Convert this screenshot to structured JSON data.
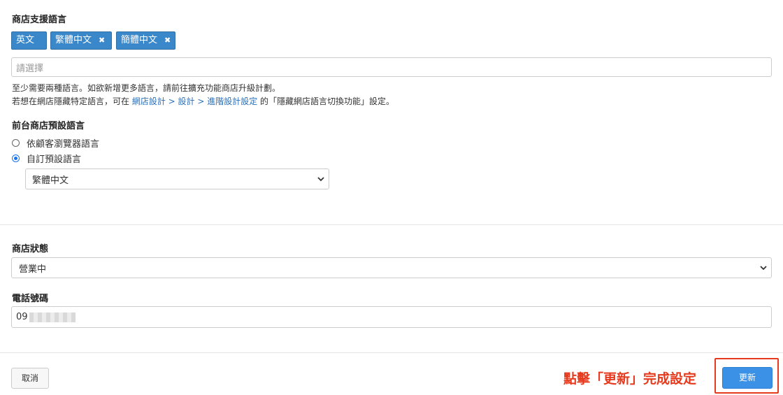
{
  "language": {
    "title": "商店支援語言",
    "tags": [
      {
        "label": "英文",
        "removable": false
      },
      {
        "label": "繁體中文",
        "removable": true,
        "remove_glyph": "✖"
      },
      {
        "label": "簡體中文",
        "removable": true,
        "remove_glyph": "✖"
      }
    ],
    "select_placeholder": "請選擇",
    "help_line1": "至少需要兩種語言。如欲新增更多語言，請前往擴充功能商店升級計劃。",
    "help_line2_prefix": "若想在網店隱藏特定語言，可在",
    "help_line2_link": "網店設計 > 設計 > 進階設計設定",
    "help_line2_suffix": "的「隱藏網店語言切換功能」設定。"
  },
  "default_language": {
    "title": "前台商店預設語言",
    "options": [
      {
        "label": "依顧客瀏覽器語言",
        "selected": false
      },
      {
        "label": "自訂預設語言",
        "selected": true
      }
    ],
    "custom_value": "繁體中文"
  },
  "store_status": {
    "title": "商店狀態",
    "value": "營業中"
  },
  "phone": {
    "title": "電話號碼",
    "value_visible": "09"
  },
  "actions": {
    "cancel_label": "取消",
    "update_label": "更新"
  },
  "annotation": {
    "text": "點擊「更新」完成設定",
    "color": "#e53a1d"
  },
  "colors": {
    "tag_bg": "#3a87c9",
    "link": "#2a6fb8",
    "primary_button": "#3a91e6"
  },
  "icons": {
    "remove": "close-icon",
    "dropdown": "chevron-down-icon"
  }
}
